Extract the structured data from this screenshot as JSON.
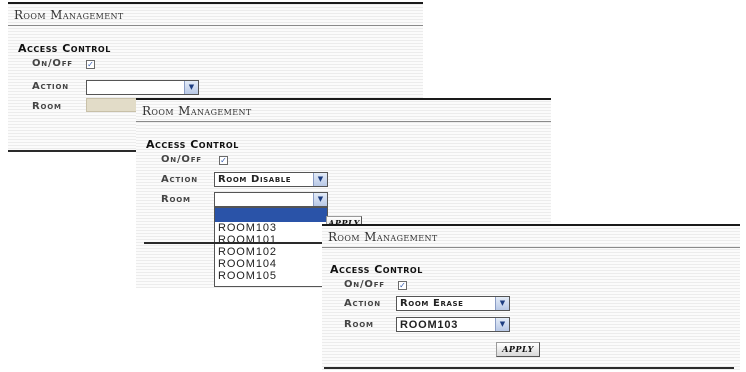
{
  "panels": [
    {
      "title": "Room Management",
      "section": "Access Control",
      "onoff_label": "On/Off",
      "onoff_checked": true,
      "action_label": "Action",
      "action_value": "",
      "room_label": "Room"
    },
    {
      "title": "Room Management",
      "section": "Access Control",
      "onoff_label": "On/Off",
      "onoff_checked": true,
      "action_label": "Action",
      "action_value": "Room Disable",
      "room_label": "Room",
      "room_value": "",
      "room_options": [
        "ROOM103",
        "ROOM101",
        "ROOM102",
        "ROOM104",
        "ROOM105"
      ],
      "apply_label": "APPLY"
    },
    {
      "title": "Room Management",
      "section": "Access Control",
      "onoff_label": "On/Off",
      "onoff_checked": true,
      "action_label": "Action",
      "action_value": "Room Erase",
      "room_label": "Room",
      "room_value": "ROOM103",
      "apply_label": "APPLY"
    }
  ],
  "icons": {
    "checkbox": "check-icon",
    "dropdown": "chevron-down-icon"
  },
  "colors": {
    "highlight": "#2a53a8",
    "check": "#3a5fb0",
    "disabled_field": "#e2dcc8"
  }
}
